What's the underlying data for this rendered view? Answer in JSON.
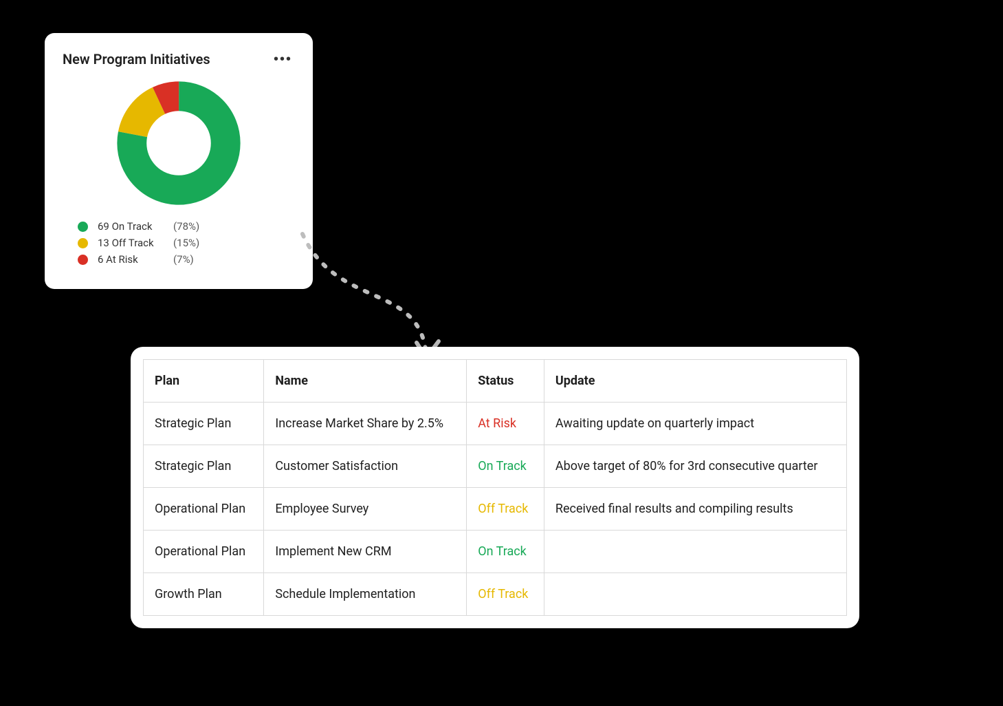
{
  "card": {
    "title": "New Program Initiatives",
    "more_label": "•••",
    "legend": [
      {
        "count": 69,
        "label": "On Track",
        "pct": "(78%)",
        "color": "#18a957"
      },
      {
        "count": 13,
        "label": "Off Track",
        "pct": "(15%)",
        "color": "#e6b800"
      },
      {
        "count": 6,
        "label": "At Risk",
        "pct": "(7%)",
        "color": "#d93025"
      }
    ]
  },
  "chart_data": {
    "type": "pie",
    "title": "New Program Initiatives",
    "categories": [
      "On Track",
      "Off Track",
      "At Risk"
    ],
    "values": [
      69,
      13,
      6
    ],
    "percentages": [
      78,
      15,
      7
    ],
    "colors": [
      "#18a957",
      "#e6b800",
      "#d93025"
    ],
    "donut": true
  },
  "table": {
    "headers": [
      "Plan",
      "Name",
      "Status",
      "Update"
    ],
    "rows": [
      {
        "plan": "Strategic Plan",
        "name": "Increase Market Share by 2.5%",
        "status": "At Risk",
        "status_class": "status-risk",
        "update": "Awaiting update on quarterly impact"
      },
      {
        "plan": "Strategic Plan",
        "name": "Customer Satisfaction",
        "status": "On Track",
        "status_class": "status-on",
        "update": "Above target of 80% for 3rd consecutive quarter"
      },
      {
        "plan": "Operational Plan",
        "name": "Employee Survey",
        "status": "Off Track",
        "status_class": "status-off",
        "update": "Received final results and compiling results"
      },
      {
        "plan": "Operational Plan",
        "name": "Implement New CRM",
        "status": "On Track",
        "status_class": "status-on",
        "update": ""
      },
      {
        "plan": "Growth Plan",
        "name": "Schedule Implementation",
        "status": "Off Track",
        "status_class": "status-off",
        "update": ""
      }
    ]
  }
}
